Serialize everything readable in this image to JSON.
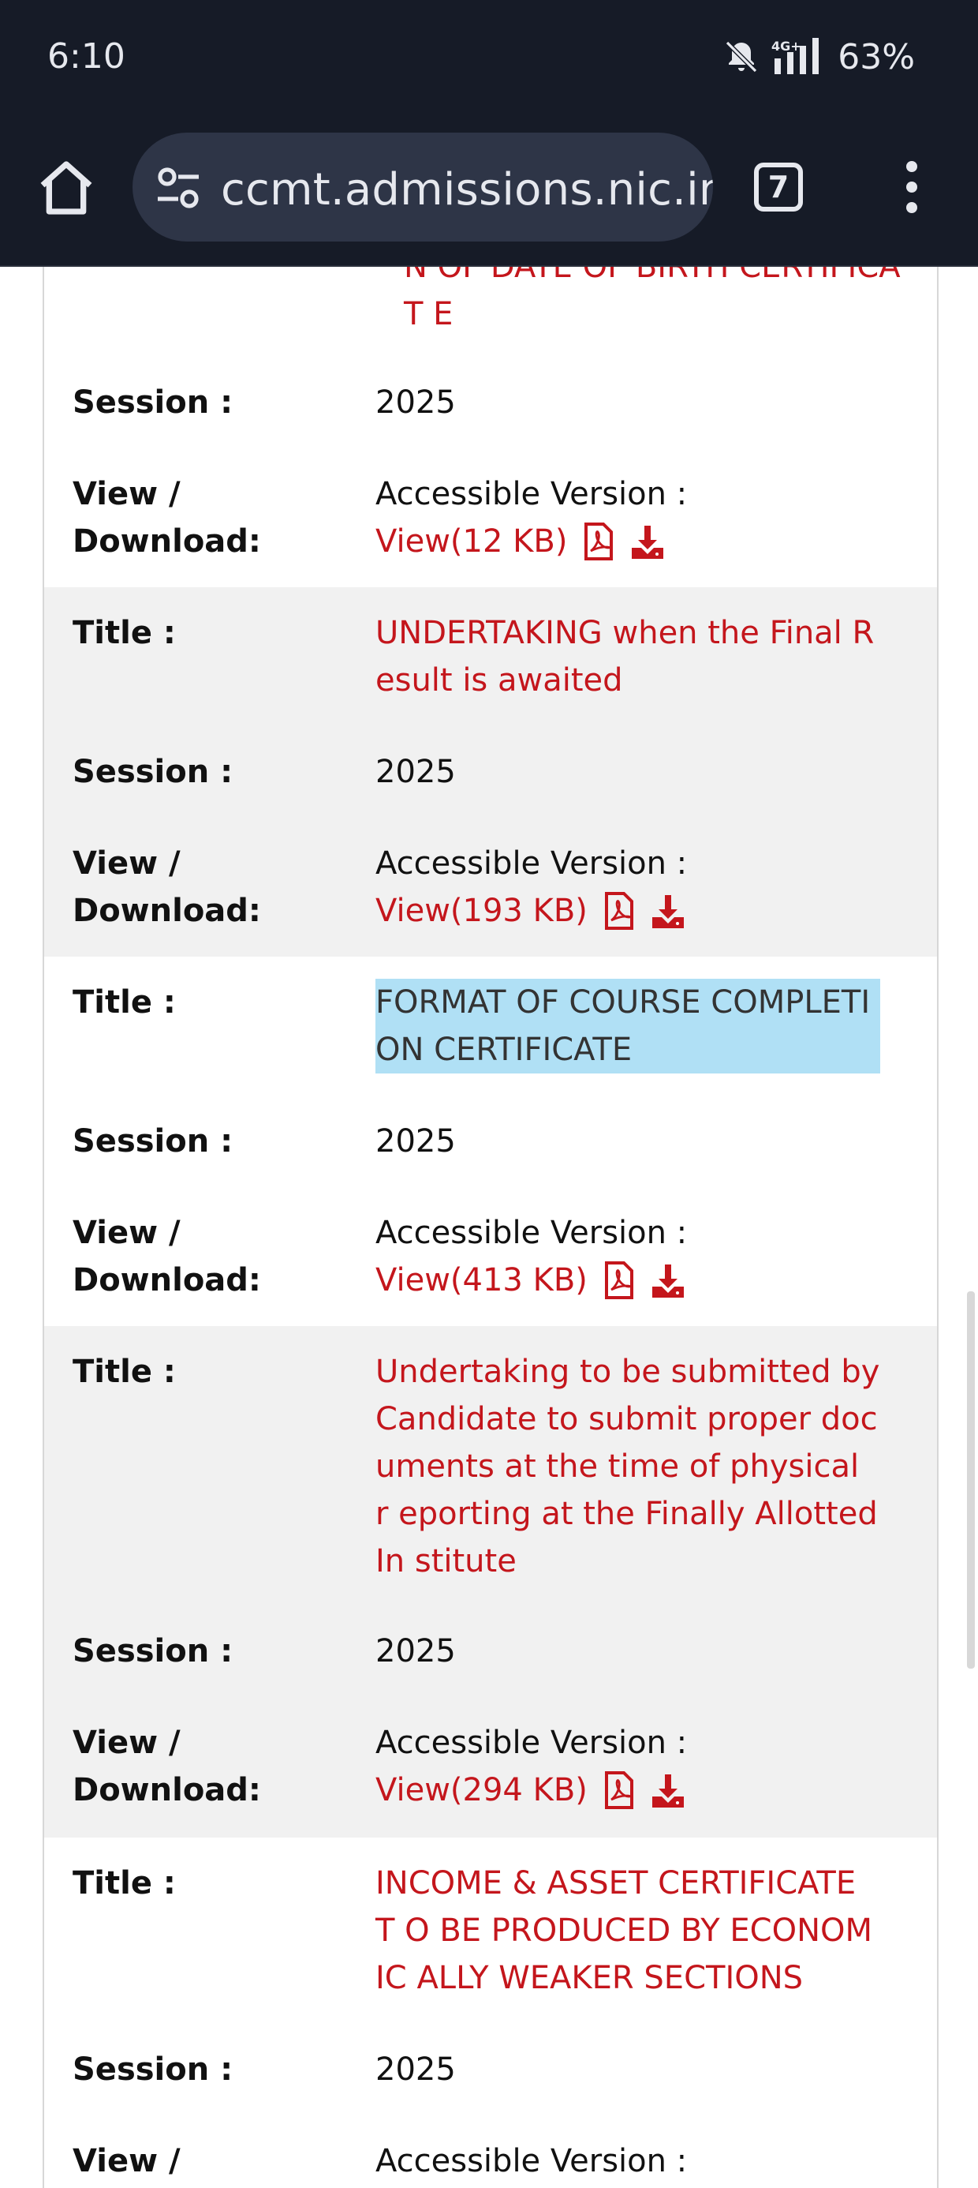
{
  "status_bar": {
    "time": "6:10",
    "network": "4G+",
    "battery": "63%",
    "icons": [
      "bell-off-icon",
      "signal-icon"
    ]
  },
  "browser": {
    "url": "ccmt.admissions.nic.in/c",
    "tab_count": "7",
    "icons": [
      "home-icon",
      "site-settings-icon",
      "more-icon"
    ]
  },
  "labels": {
    "title": "Title :",
    "session": "Session :",
    "view_download": "View / Download:",
    "accessible": "Accessible Version :"
  },
  "partial_top": {
    "title_visible": "N OF DATE OF BIRTH CERTIFICAT E",
    "session": "2025",
    "view": "View(12 KB)"
  },
  "records": [
    {
      "title": "UNDERTAKING when the Final R esult is awaited",
      "session": "2025",
      "view": "View(193 KB)"
    },
    {
      "title": "FORMAT OF COURSE COMPLETI ON CERTIFICATE",
      "session": "2025",
      "view": "View(413 KB)",
      "highlighted": true
    },
    {
      "title": "Undertaking to be submitted by Candidate to submit proper doc uments at the time of physical r eporting at the Finally Allotted In stitute",
      "session": "2025",
      "view": "View(294 KB)"
    },
    {
      "title": "INCOME & ASSET CERTIFICATE T O BE PRODUCED BY ECONOMIC ALLY WEAKER SECTIONS",
      "session": "2025"
    }
  ],
  "colors": {
    "link_red": "#c4161c",
    "row_grey": "#f1f1f1",
    "highlight": "#b0e0f5",
    "chrome_dark": "#161b27"
  }
}
